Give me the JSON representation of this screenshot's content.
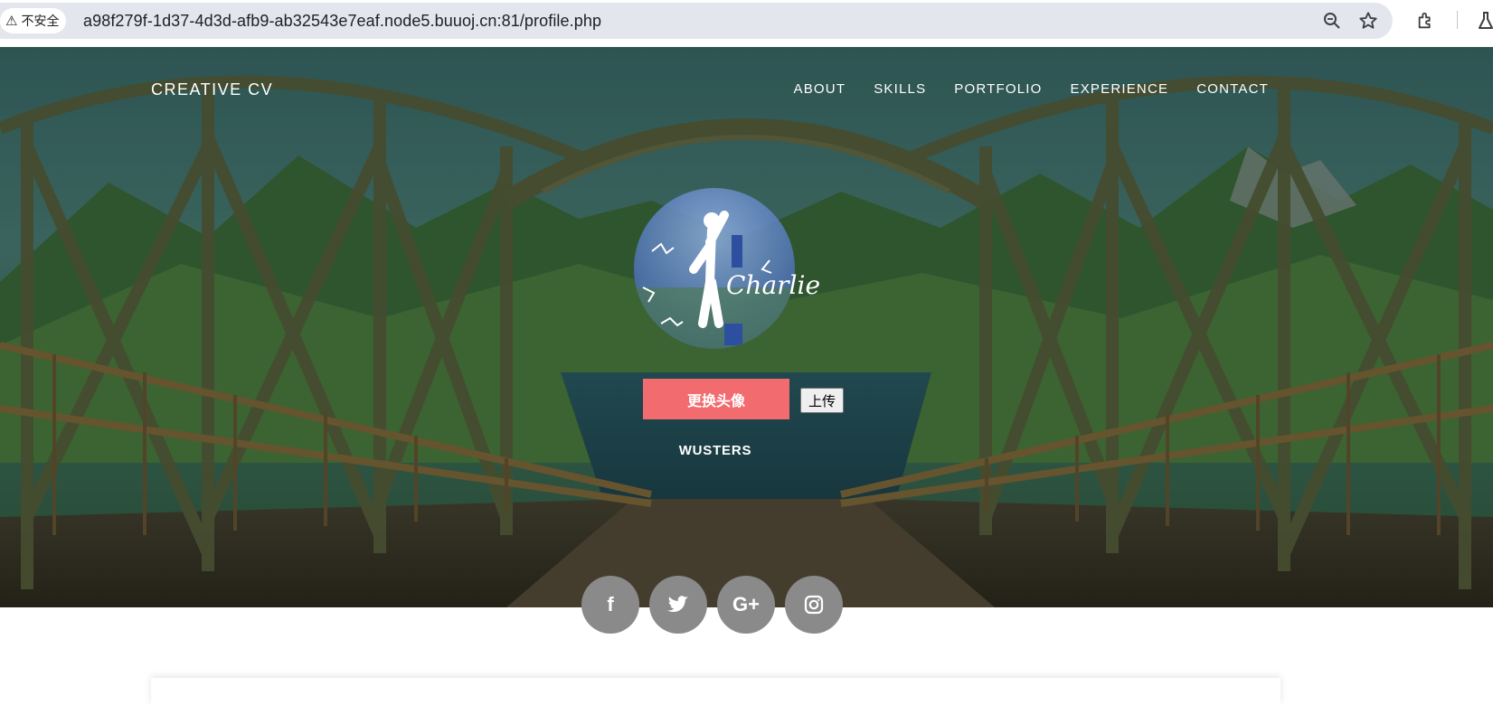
{
  "browser": {
    "security_label": "不安全",
    "url": "a98f279f-1d37-4d3d-afb9-ab32543e7eaf.node5.buuoj.cn:81/profile.php"
  },
  "site": {
    "brand": "CREATIVE CV",
    "nav": [
      {
        "label": "ABOUT"
      },
      {
        "label": "SKILLS"
      },
      {
        "label": "PORTFOLIO"
      },
      {
        "label": "EXPERIENCE"
      },
      {
        "label": "CONTACT"
      }
    ]
  },
  "profile": {
    "avatar_text": "Charlie",
    "change_avatar_label": "更换头像",
    "upload_label": "上传",
    "username": "WUSTERS"
  },
  "social": [
    {
      "icon": "facebook-icon",
      "glyph": "f"
    },
    {
      "icon": "twitter-icon",
      "glyph": "🐦"
    },
    {
      "icon": "google-plus-icon",
      "glyph": "G+"
    },
    {
      "icon": "instagram-icon",
      "glyph": "◎"
    }
  ],
  "colors": {
    "accent": "#f26b6f",
    "social_bg": "#8a8a8a"
  }
}
